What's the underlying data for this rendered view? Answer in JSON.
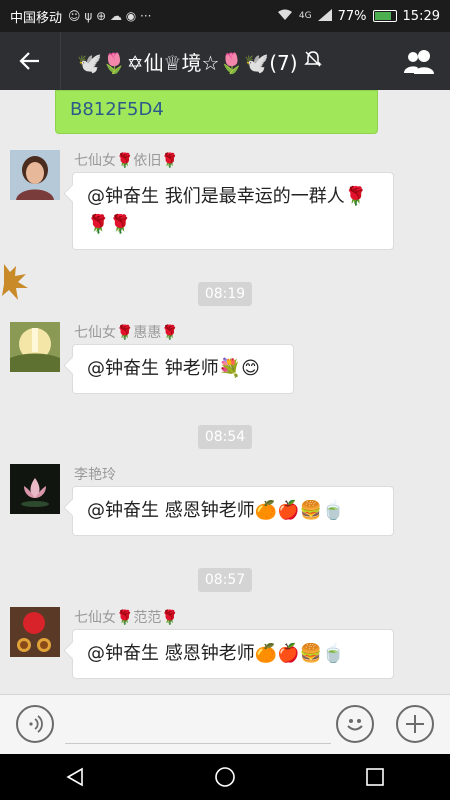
{
  "status_bar": {
    "carrier": "中国移动",
    "network": "4G",
    "battery_percent": "77%",
    "battery_level": 0.77,
    "time": "15:29"
  },
  "header": {
    "title": "🕊️🌷✡仙♕境☆🌷🕊️(7)",
    "icons": {
      "back": "back-arrow-icon",
      "mute": "mute-icon",
      "members": "group-members-icon"
    }
  },
  "chat": {
    "own_message_partial": "B812F5D4",
    "messages": [
      {
        "sender": "七仙女🌹依旧🌹",
        "text": "@钟奋生 我们是最幸运的一群人🌹🌹🌹"
      },
      {
        "timestamp": "08:19",
        "sender": "七仙女🌹惠惠🌹",
        "text": "@钟奋生 钟老师💐😊"
      },
      {
        "timestamp": "08:54",
        "sender": "李艳玲",
        "text": "@钟奋生 感恩钟老师🍊🍎🍔🍵"
      },
      {
        "timestamp": "08:57",
        "sender": "七仙女🌹范范🌹",
        "text": "@钟奋生 感恩钟老师🍊🍎🍔🍵"
      }
    ]
  },
  "input_bar": {
    "icons": {
      "voice": "voice-input-icon",
      "emoji": "emoji-icon",
      "more": "plus-icon"
    },
    "placeholder": ""
  },
  "nav_bar": {
    "icons": [
      "back-triangle-icon",
      "home-circle-icon",
      "recents-square-icon"
    ]
  },
  "colors": {
    "title_bar": "#2e2f33",
    "chat_background": "#ebebeb",
    "own_bubble": "#a0e75a",
    "accent": "#4caf50"
  }
}
